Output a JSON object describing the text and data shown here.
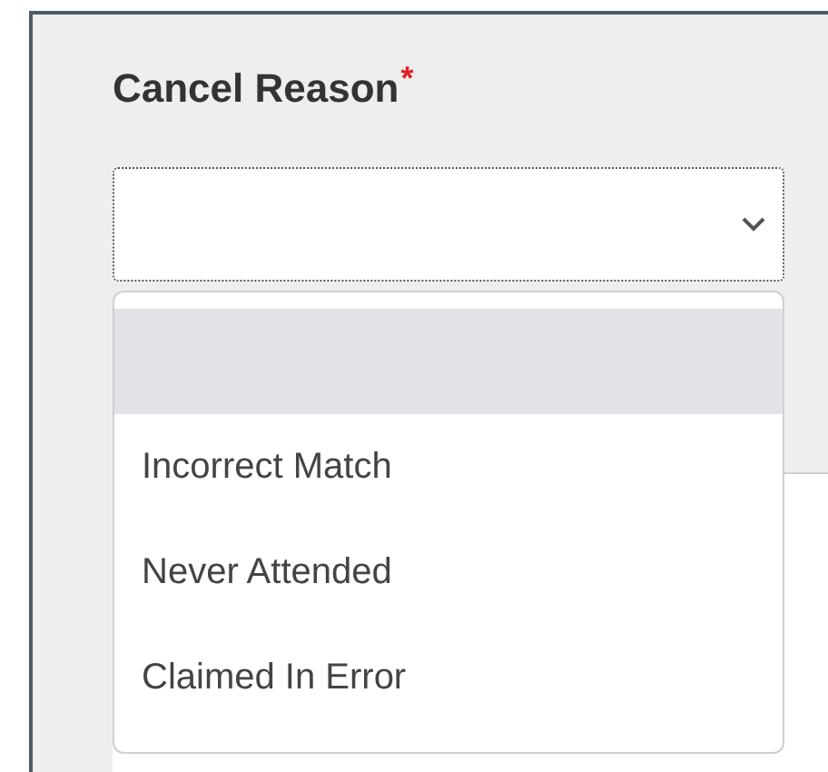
{
  "field": {
    "label": "Cancel Reason",
    "required_mark": "*",
    "expanded": true
  },
  "options": [
    {
      "selected": true
    },
    {
      "label": "Incorrect Match",
      "selected": false
    },
    {
      "label": "Never Attended",
      "selected": false
    },
    {
      "label": "Claimed In Error",
      "selected": false
    }
  ]
}
